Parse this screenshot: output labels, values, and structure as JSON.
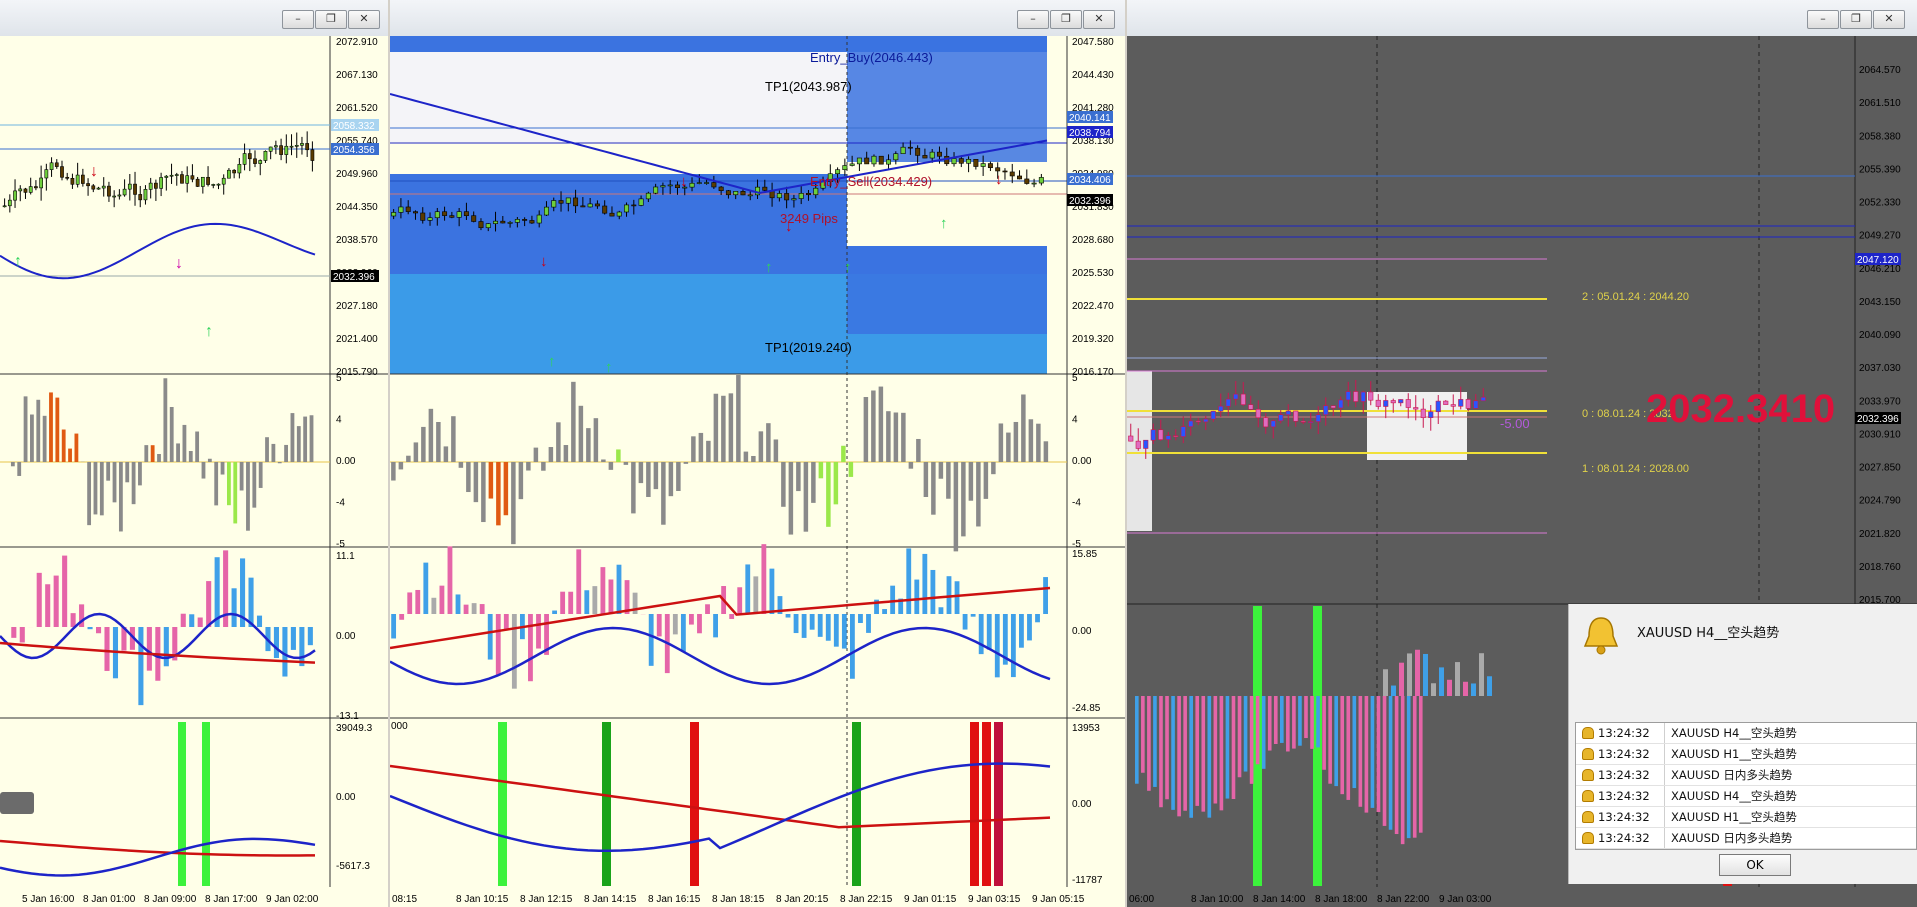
{
  "window_left": {
    "controls": [
      "–",
      "❐",
      "✕"
    ],
    "price_axis": [
      "2072.910",
      "2067.130",
      "2061.520",
      "2055.740",
      "2049.960",
      "2044.350",
      "2038.570",
      "2032.960",
      "2027.180",
      "2021.400",
      "2015.790"
    ],
    "price_tags": [
      "2058.332",
      "2054.356",
      "2032.396"
    ],
    "ind1_axis": [
      "5",
      "4",
      "0.00",
      "-4",
      "-5"
    ],
    "ind2_axis": [
      "11.1",
      "0.00",
      "-13.1"
    ],
    "ind3_axis": [
      "39049.3",
      "0.00",
      "-5617.3"
    ],
    "time_axis": [
      "5 Jan 16:00",
      "8 Jan 01:00",
      "8 Jan 09:00",
      "8 Jan 17:00",
      "9 Jan 02:00"
    ]
  },
  "window_mid": {
    "controls": [
      "–",
      "❐",
      "✕"
    ],
    "price_axis": [
      "2047.580",
      "2044.430",
      "2041.280",
      "2038.130",
      "2034.980",
      "2031.830",
      "2028.680",
      "2025.530",
      "2022.470",
      "2019.320",
      "2016.170"
    ],
    "price_tags": [
      "2040.141",
      "2038.794",
      "2034.406",
      "2032.396"
    ],
    "annotations": {
      "entry_buy": "Entry_Buy(2046.443)",
      "tp1_top": "TP1(2043.987)",
      "entry_sell": "Entry_Sell(2034.429)",
      "pips": "3249 Pips",
      "tp1_bottom": "TP1(2019.240)"
    },
    "ind1_axis": [
      "5",
      "4",
      "0.00",
      "-4",
      "-5"
    ],
    "ind2_axis": [
      "15.85",
      "0.00",
      "-24.85"
    ],
    "ind3_axis": [
      "13953",
      "0.00",
      "-11787"
    ],
    "ind3_left": "000",
    "time_axis": [
      "08:15",
      "8 Jan 10:15",
      "8 Jan 12:15",
      "8 Jan 14:15",
      "8 Jan 16:15",
      "8 Jan 18:15",
      "8 Jan 20:15",
      "8 Jan 22:15",
      "9 Jan 01:15",
      "9 Jan 03:15",
      "9 Jan 05:15"
    ]
  },
  "window_right": {
    "controls": [
      "–",
      "❐",
      "✕"
    ],
    "price_axis": [
      "2064.570",
      "2061.510",
      "2058.380",
      "2055.390",
      "2052.330",
      "2049.270",
      "2046.210",
      "2043.150",
      "2040.090",
      "2037.030",
      "2033.970",
      "2030.910",
      "2027.850",
      "2024.790",
      "2021.820",
      "2018.760",
      "2015.700"
    ],
    "price_tags": [
      "2047.120",
      "2032.396"
    ],
    "big_price": "2032.3410",
    "level_2": "2 : 05.01.24 : 2044.20",
    "level_0": "0 : 08.01.24 : 2032.",
    "level_1": "1 : 08.01.24 : 2028.00",
    "small_value": "-5.00",
    "time_axis": [
      "06:00",
      "8 Jan 10:00",
      "8 Jan 14:00",
      "8 Jan 18:00",
      "8 Jan 22:00",
      "9 Jan 03:00"
    ]
  },
  "alert": {
    "title": "XAUUSD  H4__空头趋势",
    "rows": [
      {
        "time": "13:24:32",
        "msg": "XAUUSD  H4__空头趋势"
      },
      {
        "time": "13:24:32",
        "msg": "XAUUSD  H1__空头趋势"
      },
      {
        "time": "13:24:32",
        "msg": "XAUUSD  日内多头趋势"
      },
      {
        "time": "13:24:32",
        "msg": "XAUUSD  H4__空头趋势"
      },
      {
        "time": "13:24:32",
        "msg": "XAUUSD  H1__空头趋势"
      },
      {
        "time": "13:24:32",
        "msg": "XAUUSD  日内多头趋势"
      }
    ],
    "ok": "OK"
  },
  "colors": {
    "chart_bg": "#ffffe8",
    "dark_bg": "#5c5c5c",
    "up": "#6ecf3c",
    "down": "#c0392b",
    "ma_blue": "#1d24c8",
    "ma_red": "#cc1111",
    "zone_blue": "#3b73e0",
    "zone_light": "#3b9be8",
    "pink": "#e565a8",
    "sky": "#3fa0e8"
  }
}
